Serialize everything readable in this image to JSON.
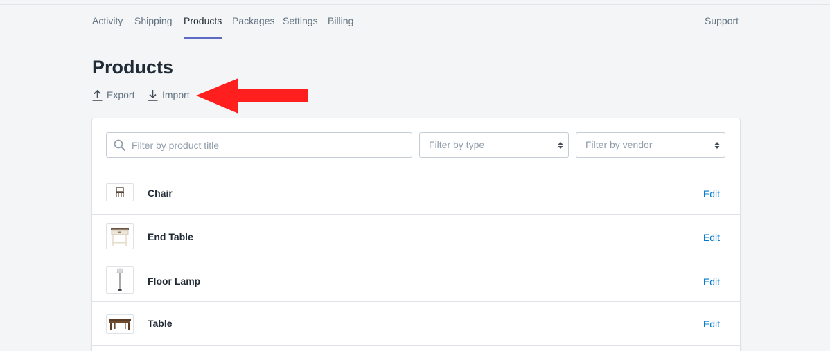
{
  "nav": {
    "tabs": [
      {
        "label": "Activity"
      },
      {
        "label": "Shipping"
      },
      {
        "label": "Products"
      },
      {
        "label": "Packages"
      },
      {
        "label": "Settings"
      },
      {
        "label": "Billing"
      }
    ],
    "active_tab": "Products",
    "support_label": "Support"
  },
  "page": {
    "title": "Products",
    "export_label": "Export",
    "import_label": "Import"
  },
  "filters": {
    "search_placeholder": "Filter by product title",
    "search_value": "",
    "type_placeholder": "Filter by type",
    "vendor_placeholder": "Filter by vendor"
  },
  "products": [
    {
      "title": "Chair",
      "edit_label": "Edit",
      "thumb_icon": "chair-icon"
    },
    {
      "title": "End Table",
      "edit_label": "Edit",
      "thumb_icon": "end-table-icon"
    },
    {
      "title": "Floor Lamp",
      "edit_label": "Edit",
      "thumb_icon": "floor-lamp-icon"
    },
    {
      "title": "Table",
      "edit_label": "Edit",
      "thumb_icon": "table-icon"
    }
  ],
  "colors": {
    "accent": "#5c6ac4",
    "link": "#007ace",
    "annotation_arrow": "#ff1f1f"
  }
}
